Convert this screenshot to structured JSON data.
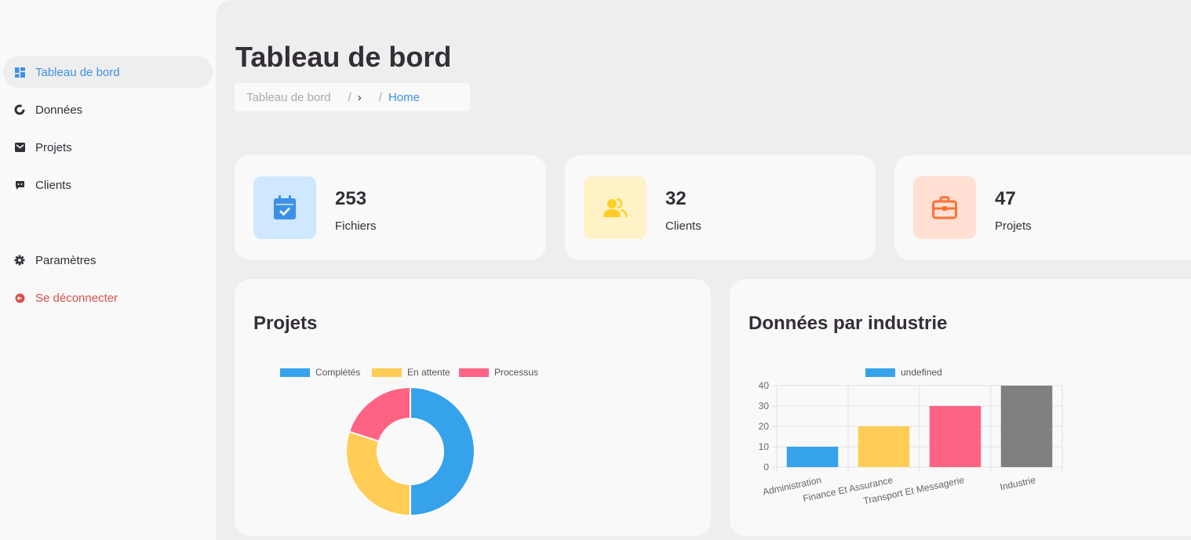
{
  "sidebar": {
    "items": [
      {
        "label": "Tableau de bord",
        "icon": "dashboard-icon",
        "active": true
      },
      {
        "label": "Données",
        "icon": "donut-icon"
      },
      {
        "label": "Projets",
        "icon": "inbox-icon"
      },
      {
        "label": "Clients",
        "icon": "message-icon"
      }
    ],
    "bottom": [
      {
        "label": "Paramètres",
        "icon": "gear-icon"
      },
      {
        "label": "Se déconnecter",
        "icon": "logout-icon"
      }
    ]
  },
  "header": {
    "title": "Tableau de bord",
    "breadcrumb": {
      "first": "Tableau de bord",
      "separator": "/",
      "chevron": "›",
      "home": "Home"
    }
  },
  "stats": [
    {
      "value": "253",
      "label": "Fichiers",
      "icon": "calendar-check-icon",
      "color": "#3c91e6",
      "bg": "#cfe8ff"
    },
    {
      "value": "32",
      "label": "Clients",
      "icon": "users-icon",
      "color": "#ffce26",
      "bg": "#fff2c6"
    },
    {
      "value": "47",
      "label": "Projets",
      "icon": "briefcase-icon",
      "color": "#fd7238",
      "bg": "#ffe0d3"
    }
  ],
  "panels": {
    "projects_title": "Projets",
    "industry_title": "Données par industrie"
  },
  "chart_data": [
    {
      "type": "pie",
      "donut": true,
      "labels": [
        "Complétés",
        "En attente",
        "Processus"
      ],
      "values": [
        50,
        30,
        20
      ],
      "colors": [
        "#36a2eb",
        "#ffcd56",
        "#ff6384"
      ],
      "legend": "top"
    },
    {
      "type": "bar",
      "categories": [
        "Administration",
        "Finance Et Assurance",
        "Transport Et Messagerie",
        "Industrie"
      ],
      "values": [
        10,
        20,
        30,
        40
      ],
      "colors": [
        "#36a2eb",
        "#ffcd56",
        "#ff6384",
        "#808080"
      ],
      "legend_label": "undefined",
      "legend_color": "#36a2eb",
      "ylim": [
        0,
        40
      ],
      "yticks": [
        0,
        10,
        20,
        30,
        40
      ],
      "grid": true
    }
  ]
}
